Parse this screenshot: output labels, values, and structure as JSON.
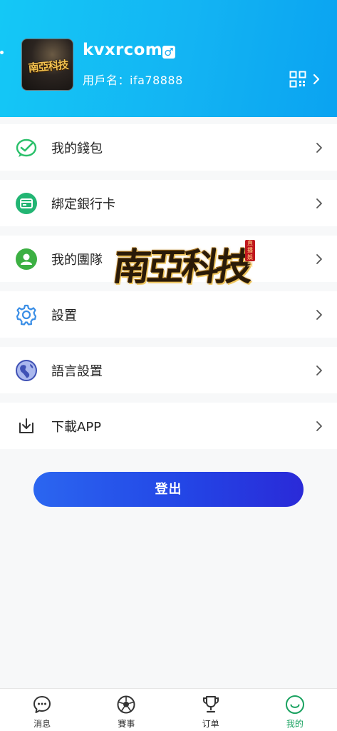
{
  "profile": {
    "nickname": "kvxrcom",
    "gender_symbol": "♂",
    "userid_text": "用戶名：ifa78888",
    "avatar_text": "南亞科技"
  },
  "menu": [
    {
      "label": "我的錢包",
      "icon": "wallet-icon",
      "color": "#2ac06a"
    },
    {
      "label": "綁定銀行卡",
      "icon": "bank-card-icon",
      "color": "#22b573"
    },
    {
      "label": "我的團隊",
      "icon": "team-icon",
      "color": "#3cb043"
    },
    {
      "label": "設置",
      "icon": "settings-gear-icon",
      "color": "#3a8ee6"
    },
    {
      "label": "語言設置",
      "icon": "language-globe-icon",
      "color": "#3f51b5"
    },
    {
      "label": "下載APP",
      "icon": "download-icon",
      "color": "#333333"
    }
  ],
  "watermark": {
    "text": "南亞科技",
    "seal_text": "直播娛樂"
  },
  "logout_label": "登出",
  "tabs": [
    {
      "label": "消息",
      "icon": "message-icon",
      "active": false
    },
    {
      "label": "賽事",
      "icon": "soccer-ball-icon",
      "active": false
    },
    {
      "label": "订单",
      "icon": "trophy-icon",
      "active": false
    },
    {
      "label": "我的",
      "icon": "smiley-profile-icon",
      "active": true
    }
  ],
  "colors": {
    "header_start": "#14c8f6",
    "header_end": "#0aa3f1",
    "button_start": "#2b66f0",
    "button_end": "#2a2ad8",
    "active_tab": "#1aa260"
  }
}
